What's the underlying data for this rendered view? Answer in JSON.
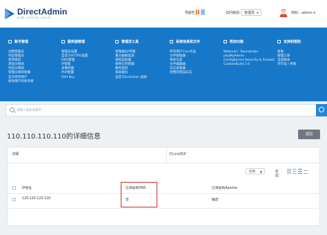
{
  "app": {
    "name": "DirectAdmin",
    "tagline": "web control panel"
  },
  "header": {
    "nav_label": "导航栏",
    "access_label": "访问级别",
    "role_value": "管理员",
    "greeting": "你好，admin"
  },
  "menu": {
    "columns": [
      {
        "title": "账号管理",
        "icon": "user-group-icon",
        "items": [
          "创建管理员",
          "列出管理员",
          "更改密码",
          "添加分销商",
          "列出分销商",
          "管理分销商套餐",
          "显示所有用户",
          "修改用户的所有者"
        ]
      },
      {
        "title": "服务器管理",
        "icon": "server-icon",
        "items": [
          "管理员设置",
          "自定义HTTPD设置",
          "DNS管理",
          "IP管理",
          "多服务器",
          "PHP配置",
          "SSH Key"
        ]
      },
      {
        "title": "管理员工具",
        "icon": "tools-icon",
        "items": [
          "管理备份/传输",
          "暴力破解监测",
          "进程监视器",
          "邮件队列管理",
          "服务监控",
          "系统备份",
          "自定义Evolution 皮肤"
        ]
      },
      {
        "title": "系统信息和文件",
        "icon": "info-icon",
        "items": [
          "所有用户Cron作业",
          "文件管理器",
          "系统信息",
          "文件编辑器",
          "日志查看器",
          "完整的错误日志"
        ]
      },
      {
        "title": "附加功能",
        "icon": "plus-icon",
        "items": [
          "Webmail：Roundcube",
          "phpMyAdmin",
          "ConfigServer Security & Firewall",
          "CustomBuild 2.0"
        ]
      },
      {
        "title": "支持和帮助",
        "icon": "help-icon",
        "items": [
          "帮助",
          "管理工单",
          "当前版本",
          "许可证 / 更新"
        ]
      }
    ]
  },
  "search": {
    "placeholder": "请输入搜索关键字..."
  },
  "page": {
    "title": "110.110.110.110的详细信息",
    "back_label": "返回"
  },
  "card": {
    "left_header": "详细",
    "right_header": "已Link的IP",
    "columns_select": "栏目",
    "density_label": "密度：",
    "table": {
      "headers": [
        "IP地址",
        "已添加到DNS",
        "已添加到Apache"
      ],
      "rows": [
        [
          "120.120.120.120",
          "否",
          "确定"
        ]
      ]
    }
  },
  "colors": {
    "menu_bg": "#1778c9",
    "brand": "#1d3c73",
    "highlight_box": "#d22a22",
    "back_button": "#6f7780"
  }
}
